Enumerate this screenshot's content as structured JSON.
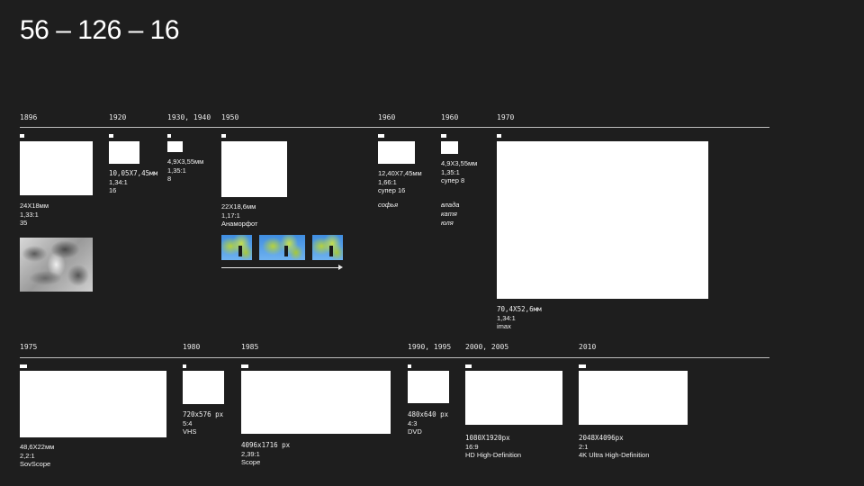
{
  "title": "56 – 126 – 16",
  "row1": {
    "years": {
      "y1896": "1896",
      "y1920": "1920",
      "y1930": "1930, 1940",
      "y1950": "1950",
      "y1960a": "1960",
      "y1960b": "1960",
      "y1970": "1970"
    },
    "formats": {
      "f35": {
        "size": "24X18мм",
        "ratio": "1,33:1",
        "name": "35"
      },
      "f16": {
        "size": "10,05X7,45мм",
        "ratio": "1,34:1",
        "name": "16"
      },
      "f8": {
        "size": "4,9X3,55мм",
        "ratio": "1,35:1",
        "name": "8"
      },
      "anamorphic": {
        "size": "22X18,6мм",
        "ratio": "1,17:1",
        "name": "Анаморфот"
      },
      "super16": {
        "size": "12,40X7,45мм",
        "ratio": "1,66:1",
        "name": "супер 16",
        "people": [
          "софья"
        ]
      },
      "super8": {
        "size": "4,9X3,55мм",
        "ratio": "1,35:1",
        "name": "супер 8",
        "people": [
          "влада",
          "катя",
          "юля"
        ]
      },
      "imax": {
        "size": "70,4X52,6мм",
        "ratio": "1,34:1",
        "name": "imax"
      }
    }
  },
  "row2": {
    "years": {
      "y1975": "1975",
      "y1980": "1980",
      "y1985": "1985",
      "y1990": "1990, 1995",
      "y2000": "2000, 2005",
      "y2010": "2010"
    },
    "formats": {
      "sovscope": {
        "size": "48,6X22мм",
        "ratio": "2,2:1",
        "name": "SovScope"
      },
      "vhs": {
        "size": "720x576 px",
        "ratio": "5:4",
        "name": "VHS"
      },
      "scope": {
        "size": "4096x1716 px",
        "ratio": "2,39:1",
        "name": "Scope"
      },
      "dvd": {
        "size": "480x640 px",
        "ratio": "4:3",
        "name": "DVD"
      },
      "hd": {
        "size": "1080X1920px",
        "ratio": "16:9",
        "name": "HD High-Definition"
      },
      "uhd": {
        "size": "2048X4096px",
        "ratio": "2:1",
        "name": "4K Ultra High-Definition"
      }
    }
  }
}
